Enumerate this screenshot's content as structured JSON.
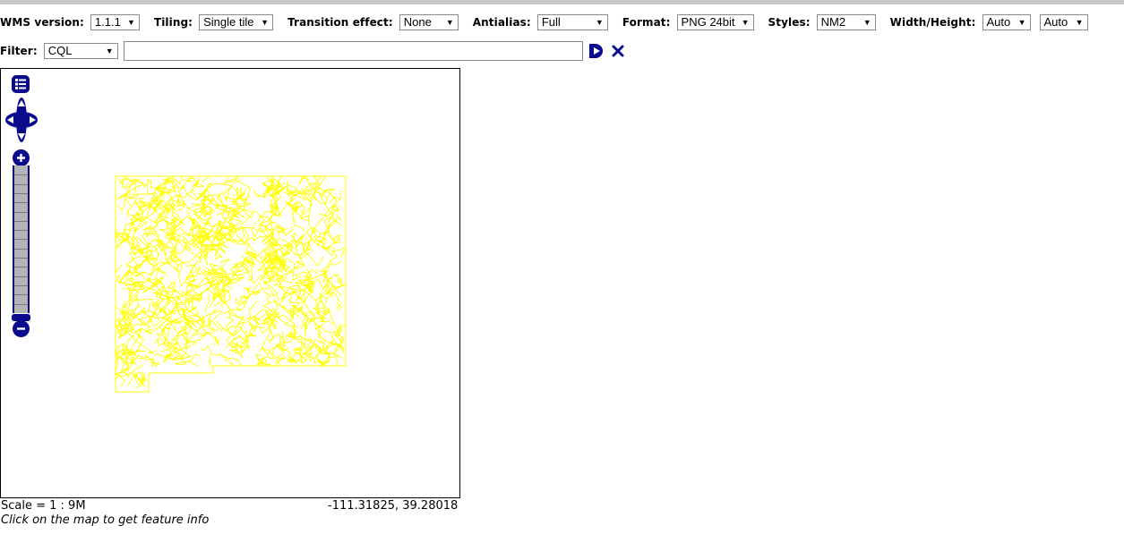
{
  "toolbar": {
    "wms_version": {
      "label": "WMS version:",
      "value": "1.1.1"
    },
    "tiling": {
      "label": "Tiling:",
      "value": "Single tile"
    },
    "transition": {
      "label": "Transition effect:",
      "value": "None"
    },
    "antialias": {
      "label": "Antialias:",
      "value": "Full"
    },
    "format": {
      "label": "Format:",
      "value": "PNG 24bit"
    },
    "styles": {
      "label": "Styles:",
      "value": "NM2"
    },
    "size": {
      "label": "Width/Height:",
      "width_value": "Auto",
      "height_value": "Auto"
    },
    "dropdown_arrow": "▼"
  },
  "filter": {
    "label": "Filter:",
    "type_value": "CQL",
    "expression": "",
    "apply_icon": "play-icon",
    "reset_icon": "close-icon"
  },
  "map": {
    "layer_color": "#ffff00",
    "accent_color": "#0a0a8c",
    "scale": "Scale = 1 : 9M",
    "coordinates": "-111.31825, 39.28018",
    "hint": "Click on the map to get feature info"
  }
}
